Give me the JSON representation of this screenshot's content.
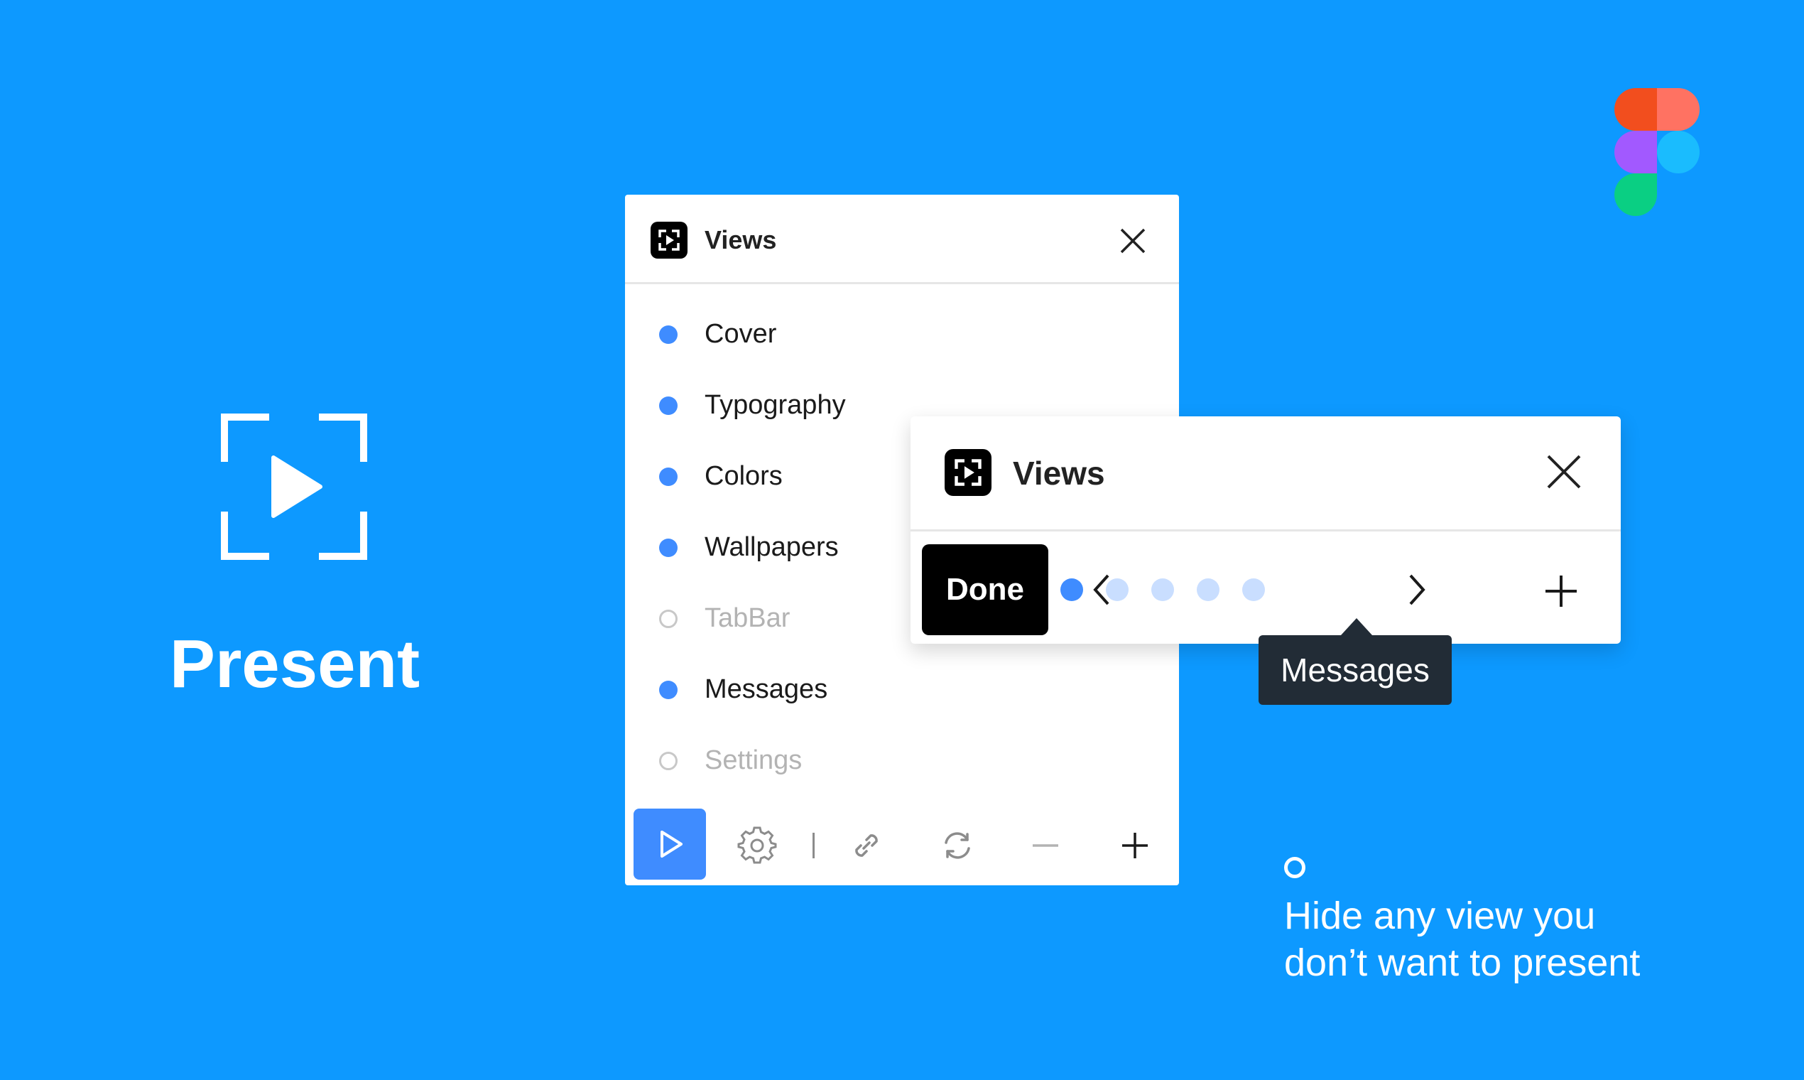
{
  "hero": {
    "title": "Present",
    "icon": "present-icon"
  },
  "brand": {
    "logo": "figma-logo"
  },
  "views_panel": {
    "title": "Views",
    "icon": "present-app-icon",
    "close_icon": "close-icon",
    "items": [
      {
        "label": "Cover",
        "visible": true
      },
      {
        "label": "Typography",
        "visible": true
      },
      {
        "label": "Colors",
        "visible": true
      },
      {
        "label": "Wallpapers",
        "visible": true
      },
      {
        "label": "TabBar",
        "visible": false
      },
      {
        "label": "Messages",
        "visible": true
      },
      {
        "label": "Settings",
        "visible": false
      }
    ],
    "toolbar": [
      "play-icon",
      "gear-icon",
      "link-icon",
      "refresh-icon",
      "minus-icon",
      "plus-icon"
    ]
  },
  "compact_panel": {
    "title": "Views",
    "done_label": "Done",
    "pager": {
      "total": 5,
      "current_index": 0
    }
  },
  "tooltip": {
    "text": "Messages"
  },
  "hint": {
    "line1": "Hide any view you",
    "line2": "don’t want to present"
  },
  "colors": {
    "background": "#0D99FF",
    "accent": "#3F8CFF",
    "pager_inactive": "#C9DEFF",
    "tooltip_bg": "#222C36"
  }
}
